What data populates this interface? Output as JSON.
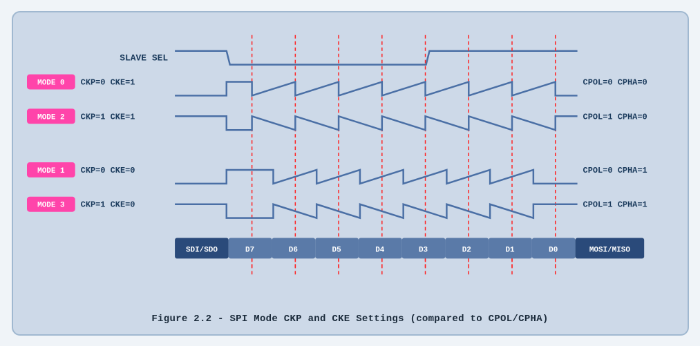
{
  "title": "Figure 2.2 - SPI Mode CKP and CKE Settings (compared to CPOL/CPHA)",
  "caption": "Figure 2.2 - SPI Mode CKP and CKE Settings (compared to CPOL/CPHA)",
  "diagram": {
    "slave_sel_label": "SLAVE SEL",
    "modes": [
      {
        "id": "MODE 0",
        "ckp_cke": "CKP=0  CKE=1",
        "cpol_cpha": "CPOL=0  CPHA=0",
        "high_start": true
      },
      {
        "id": "MODE 2",
        "ckp_cke": "CKP=1  CKE=1",
        "cpol_cpha": "CPOL=1  CPHA=0",
        "high_start": false
      },
      {
        "id": "MODE 1",
        "ckp_cke": "CKP=0  CKE=0",
        "cpol_cpha": "CPOL=0  CPHA=1",
        "high_start": true
      },
      {
        "id": "MODE 3",
        "ckp_cke": "CKP=1  CKE=0",
        "cpol_cpha": "CPOL=1  CPHA=1",
        "high_start": false
      }
    ],
    "data_bits": [
      "SDI/SDO",
      "D7",
      "D6",
      "D5",
      "D4",
      "D3",
      "D2",
      "D1",
      "D0",
      "MOSI/MISO"
    ]
  }
}
